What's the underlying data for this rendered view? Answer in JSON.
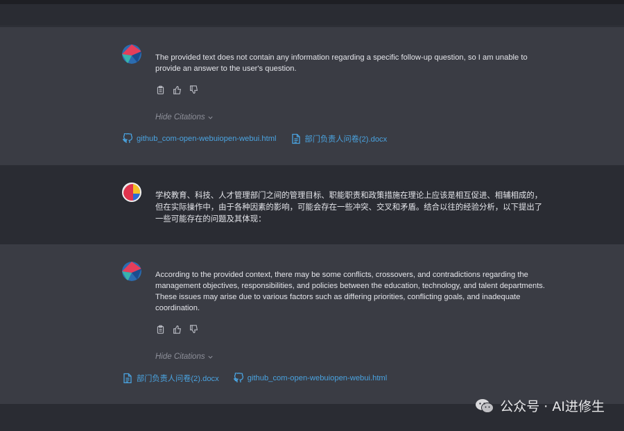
{
  "messages": [
    {
      "role": "assistant",
      "text": "The provided text does not contain any information regarding a specific follow-up question, so I am unable to provide an answer to the user's question.",
      "hide_citations_label": "Hide Citations",
      "citations": [
        {
          "icon": "github-icon",
          "label": "github_com-open-webuiopen-webui.html"
        },
        {
          "icon": "document-icon",
          "label": "部门负责人问卷(2).docx"
        }
      ]
    },
    {
      "role": "user",
      "text": "学校教育、科技、人才管理部门之间的管理目标、职能职责和政策措施在理论上应该是相互促进、相辅相成的，但在实际操作中，由于各种因素的影响，可能会存在一些冲突、交叉和矛盾。结合以往的经验分析，以下提出了一些可能存在的问题及其体现："
    },
    {
      "role": "assistant",
      "text": "According to the provided context, there may be some conflicts, crossovers, and contradictions regarding the management objectives, responsibilities, and policies between the education, technology, and talent departments. These issues may arise due to various factors such as differing priorities, conflicting goals, and inadequate coordination.",
      "hide_citations_label": "Hide Citations",
      "citations": [
        {
          "icon": "document-icon",
          "label": "部门负责人问卷(2).docx"
        },
        {
          "icon": "github-icon",
          "label": "github_com-open-webuiopen-webui.html"
        }
      ]
    }
  ],
  "watermark": {
    "text": "公众号 · AI进修生",
    "icon": "wechat-icon"
  },
  "colors": {
    "assistant_bg": "#3a3c44",
    "user_bg": "#2a2c33",
    "link": "#4aa3e0"
  }
}
